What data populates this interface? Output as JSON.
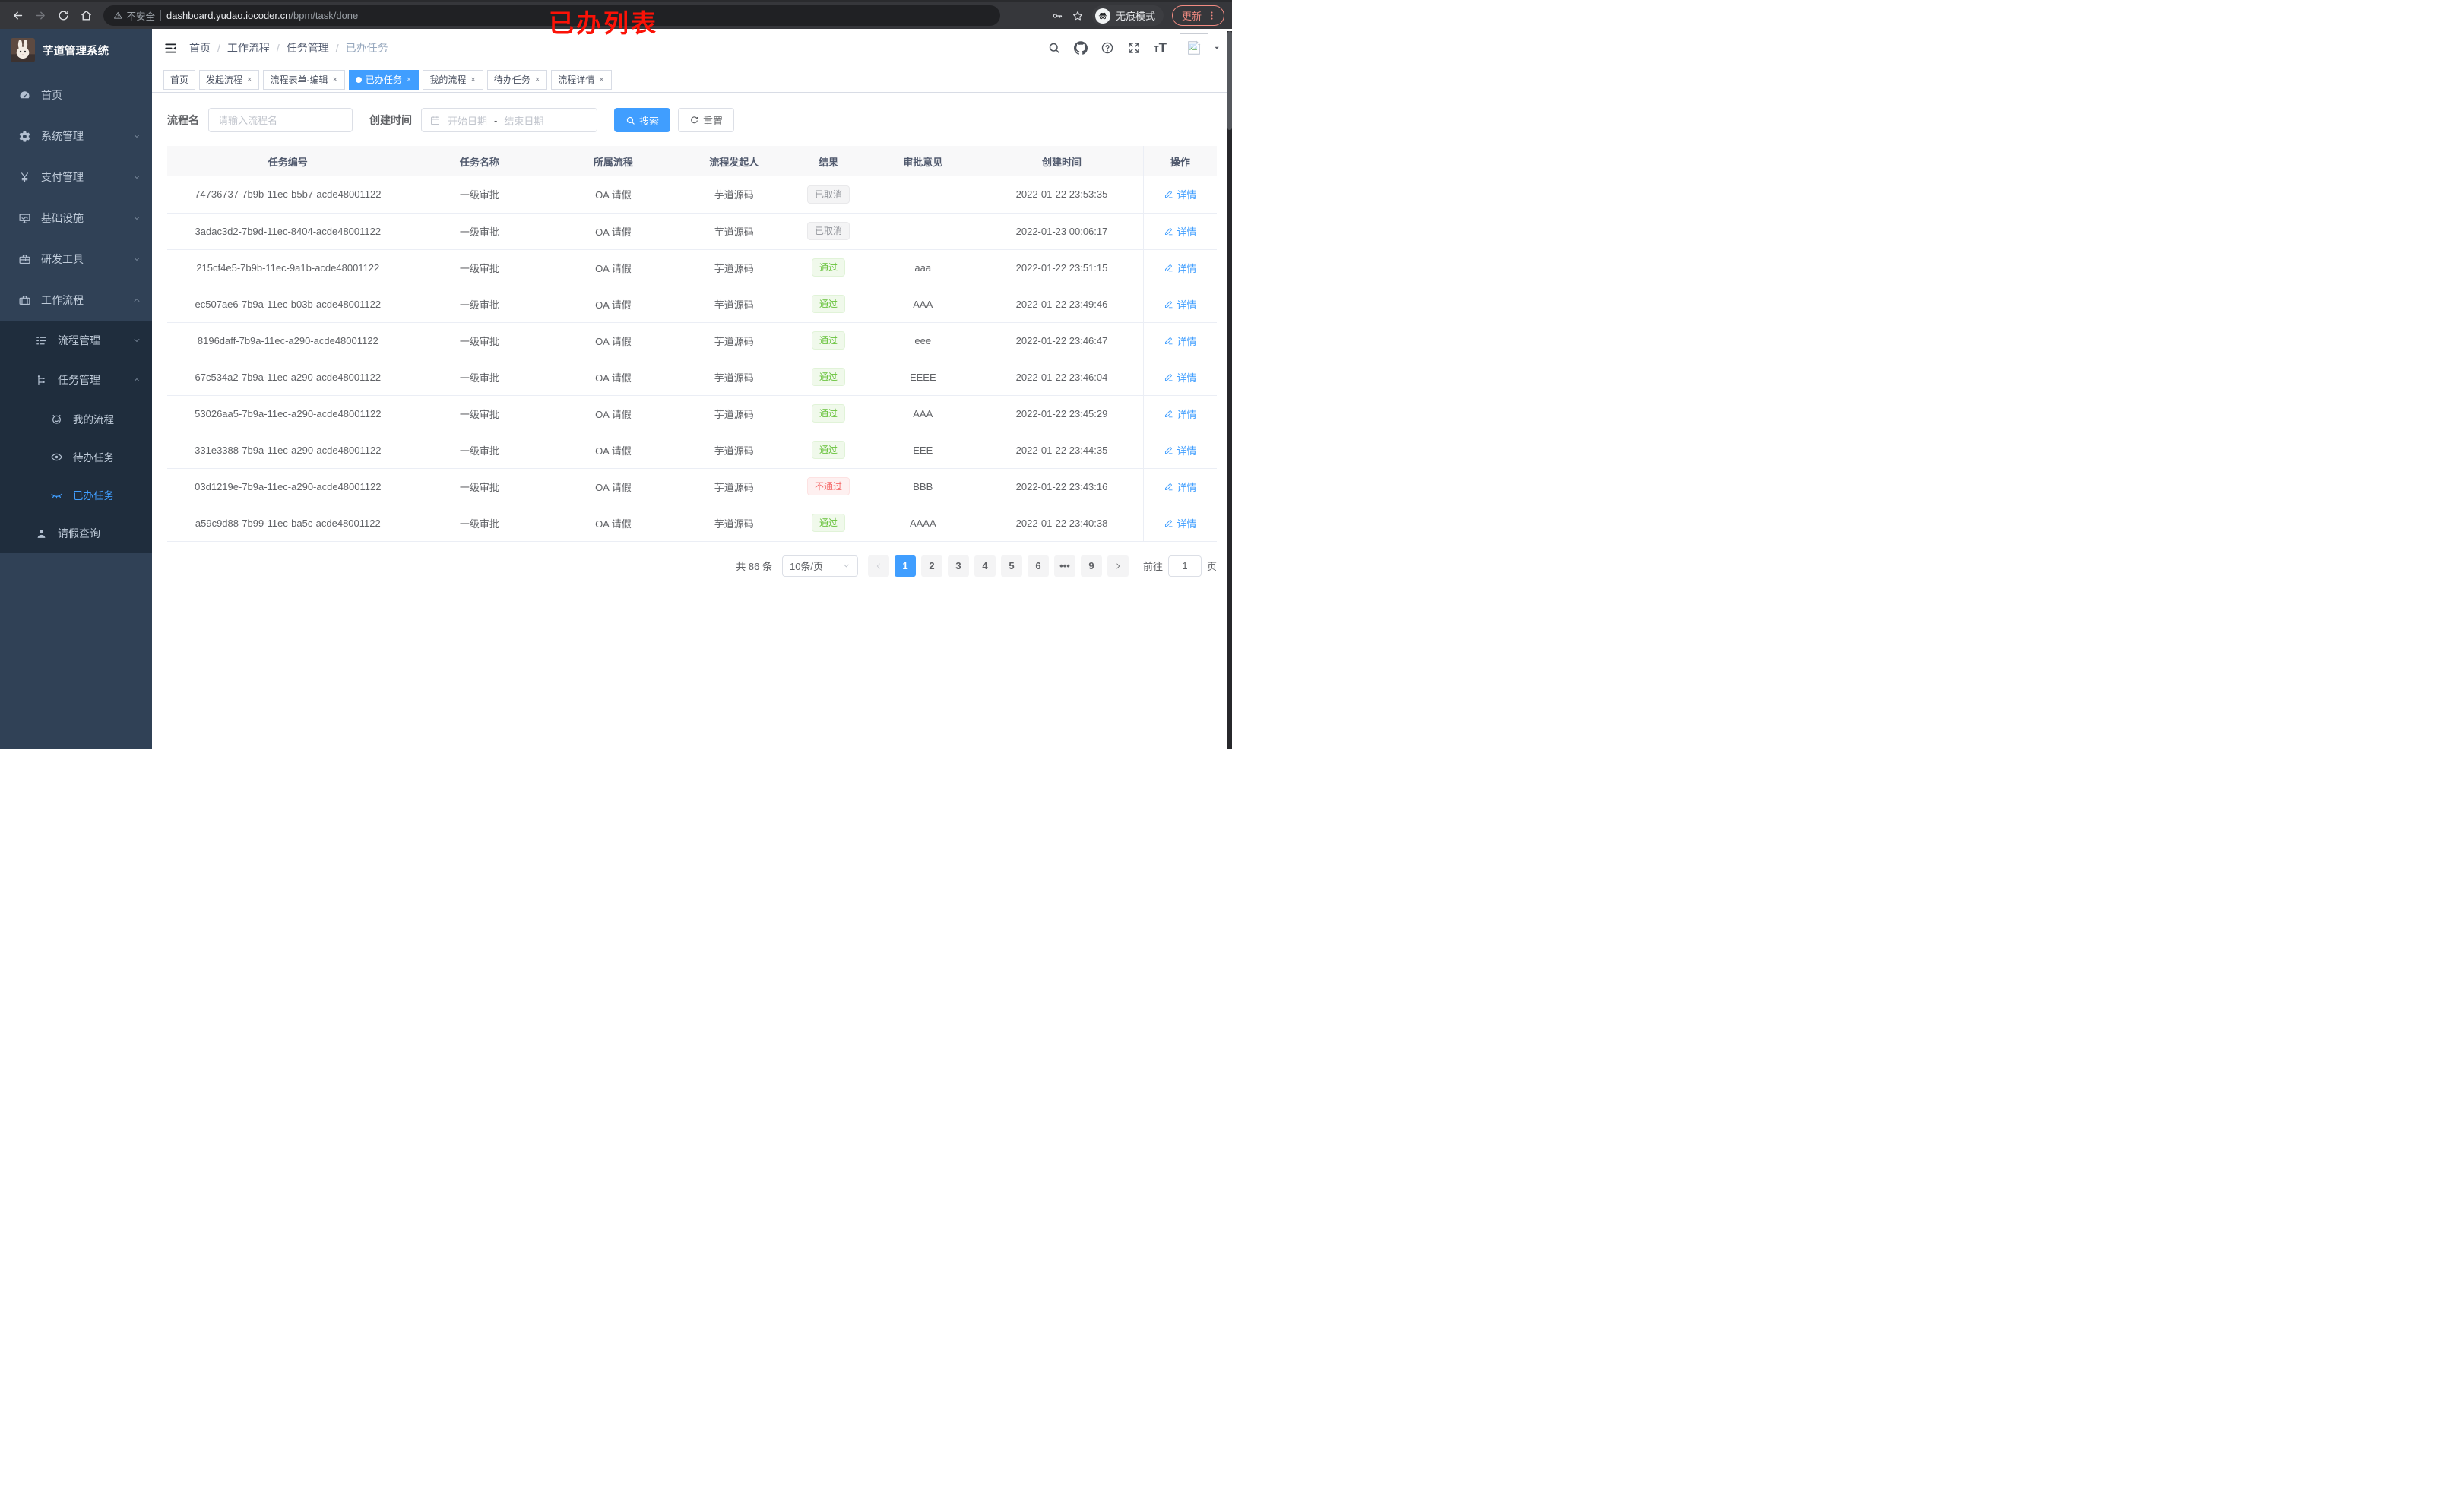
{
  "colors": {
    "accent": "#409eff",
    "success": "#67c23a",
    "danger": "#f56c6c",
    "info": "#909399",
    "sidebar_bg": "#304156",
    "submenu_bg": "#1f2d3d",
    "annotation_red": "#fb1207"
  },
  "browser": {
    "security_label": "不安全",
    "url_host": "dashboard.yudao.iocoder.cn",
    "url_path": "/bpm/task/done",
    "incognito_label": "无痕模式",
    "update_label": "更新"
  },
  "annotation": {
    "text": "已办列表"
  },
  "sidebar": {
    "logo_title": "芋道管理系统",
    "menu": [
      {
        "name": "home",
        "icon": "dashboard-icon",
        "label": "首页"
      },
      {
        "name": "system-management",
        "icon": "gear-icon",
        "label": "系统管理",
        "chevron": "down"
      },
      {
        "name": "payment-management",
        "icon": "yen-icon",
        "label": "支付管理",
        "chevron": "down"
      },
      {
        "name": "infrastructure",
        "icon": "monitor-icon",
        "label": "基础设施",
        "chevron": "down"
      },
      {
        "name": "dev-tools",
        "icon": "toolbox-icon",
        "label": "研发工具",
        "chevron": "down"
      },
      {
        "name": "workflow",
        "icon": "briefcase-icon",
        "label": "工作流程",
        "chevron": "up",
        "children": [
          {
            "name": "process-management",
            "icon": "process-list-icon",
            "label": "流程管理",
            "chevron": "down"
          },
          {
            "name": "task-management",
            "icon": "task-tree-icon",
            "label": "任务管理",
            "chevron": "up",
            "children": [
              {
                "name": "my-process",
                "icon": "robot-icon",
                "label": "我的流程"
              },
              {
                "name": "todo-tasks",
                "icon": "eye-open-icon",
                "label": "待办任务"
              },
              {
                "name": "done-tasks",
                "icon": "eye-closed-icon",
                "label": "已办任务",
                "active": true
              }
            ]
          },
          {
            "name": "leave-query",
            "icon": "user-icon",
            "label": "请假查询"
          }
        ]
      }
    ]
  },
  "navbar": {
    "breadcrumb": [
      "首页",
      "工作流程",
      "任务管理",
      "已办任务"
    ]
  },
  "tabs": [
    {
      "name": "home",
      "label": "首页"
    },
    {
      "name": "start-process",
      "label": "发起流程",
      "closable": true
    },
    {
      "name": "form-edit",
      "label": "流程表单-编辑",
      "closable": true
    },
    {
      "name": "done-tasks",
      "label": "已办任务",
      "closable": true,
      "active": true
    },
    {
      "name": "my-process",
      "label": "我的流程",
      "closable": true
    },
    {
      "name": "todo-tasks",
      "label": "待办任务",
      "closable": true
    },
    {
      "name": "process-detail",
      "label": "流程详情",
      "closable": true
    }
  ],
  "filter": {
    "name_label": "流程名",
    "name_placeholder": "请输入流程名",
    "time_label": "创建时间",
    "start_placeholder": "开始日期",
    "range_separator": "-",
    "end_placeholder": "结束日期",
    "search_label": "搜索",
    "reset_label": "重置"
  },
  "table": {
    "columns": [
      "任务编号",
      "任务名称",
      "所属流程",
      "流程发起人",
      "结果",
      "审批意见",
      "创建时间",
      "操作"
    ],
    "action_label": "详情",
    "rows": [
      {
        "id": "74736737-7b9b-11ec-b5b7-acde48001122",
        "name": "一级审批",
        "process": "OA 请假",
        "starter": "芋道源码",
        "result": "已取消",
        "result_type": "info",
        "opinion": "",
        "time": "2022-01-22 23:53:35"
      },
      {
        "id": "3adac3d2-7b9d-11ec-8404-acde48001122",
        "name": "一级审批",
        "process": "OA 请假",
        "starter": "芋道源码",
        "result": "已取消",
        "result_type": "info",
        "opinion": "",
        "time": "2022-01-23 00:06:17"
      },
      {
        "id": "215cf4e5-7b9b-11ec-9a1b-acde48001122",
        "name": "一级审批",
        "process": "OA 请假",
        "starter": "芋道源码",
        "result": "通过",
        "result_type": "success",
        "opinion": "aaa",
        "time": "2022-01-22 23:51:15"
      },
      {
        "id": "ec507ae6-7b9a-11ec-b03b-acde48001122",
        "name": "一级审批",
        "process": "OA 请假",
        "starter": "芋道源码",
        "result": "通过",
        "result_type": "success",
        "opinion": "AAA",
        "time": "2022-01-22 23:49:46"
      },
      {
        "id": "8196daff-7b9a-11ec-a290-acde48001122",
        "name": "一级审批",
        "process": "OA 请假",
        "starter": "芋道源码",
        "result": "通过",
        "result_type": "success",
        "opinion": "eee",
        "time": "2022-01-22 23:46:47"
      },
      {
        "id": "67c534a2-7b9a-11ec-a290-acde48001122",
        "name": "一级审批",
        "process": "OA 请假",
        "starter": "芋道源码",
        "result": "通过",
        "result_type": "success",
        "opinion": "EEEE",
        "time": "2022-01-22 23:46:04"
      },
      {
        "id": "53026aa5-7b9a-11ec-a290-acde48001122",
        "name": "一级审批",
        "process": "OA 请假",
        "starter": "芋道源码",
        "result": "通过",
        "result_type": "success",
        "opinion": "AAA",
        "time": "2022-01-22 23:45:29"
      },
      {
        "id": "331e3388-7b9a-11ec-a290-acde48001122",
        "name": "一级审批",
        "process": "OA 请假",
        "starter": "芋道源码",
        "result": "通过",
        "result_type": "success",
        "opinion": "EEE",
        "time": "2022-01-22 23:44:35"
      },
      {
        "id": "03d1219e-7b9a-11ec-a290-acde48001122",
        "name": "一级审批",
        "process": "OA 请假",
        "starter": "芋道源码",
        "result": "不通过",
        "result_type": "danger",
        "opinion": "BBB",
        "time": "2022-01-22 23:43:16"
      },
      {
        "id": "a59c9d88-7b99-11ec-ba5c-acde48001122",
        "name": "一级审批",
        "process": "OA 请假",
        "starter": "芋道源码",
        "result": "通过",
        "result_type": "success",
        "opinion": "AAAA",
        "time": "2022-01-22 23:40:38"
      }
    ]
  },
  "pagination": {
    "total_label": "共 86 条",
    "page_size": "10条/页",
    "pages": [
      "1",
      "2",
      "3",
      "4",
      "5",
      "6",
      "•••",
      "9"
    ],
    "active_page": "1",
    "goto_label": "前往",
    "goto_value": "1",
    "page_unit_label": "页"
  }
}
